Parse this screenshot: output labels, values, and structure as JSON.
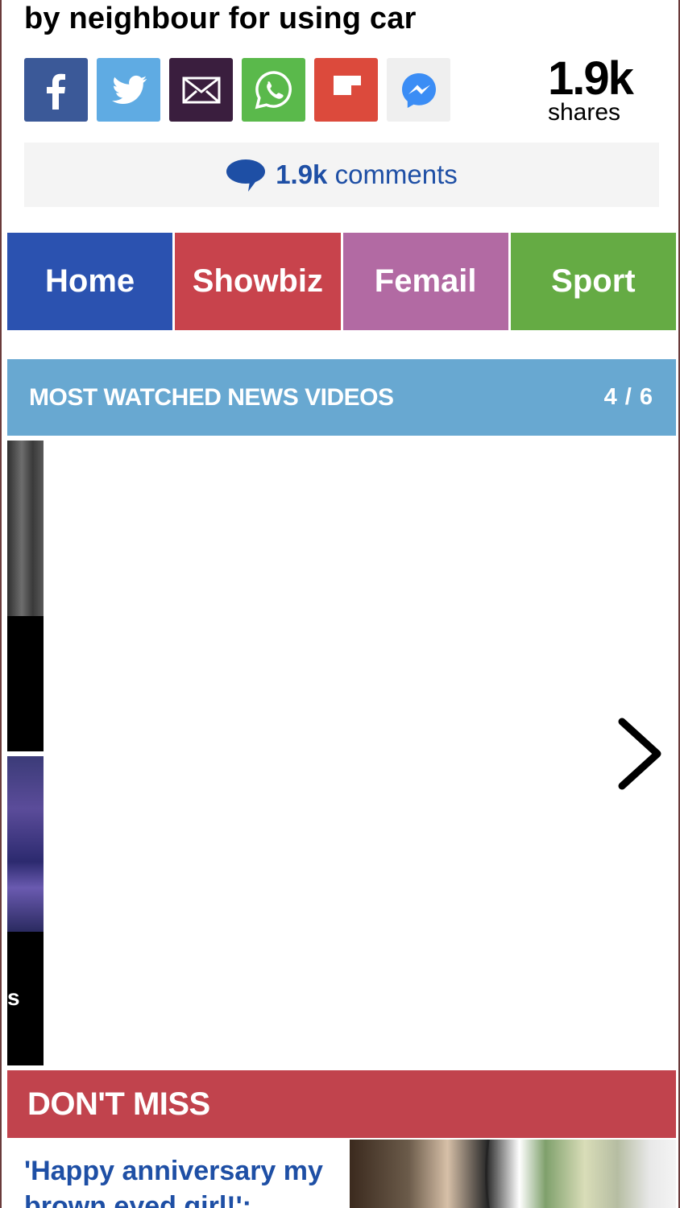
{
  "article": {
    "headline_tail": "by neighbour for using car"
  },
  "share": {
    "buttons": [
      {
        "name": "facebook",
        "icon": "facebook-icon",
        "color": "#3b5998"
      },
      {
        "name": "twitter",
        "icon": "twitter-icon",
        "color": "#5fabe3"
      },
      {
        "name": "email",
        "icon": "envelope-icon",
        "color": "#3a1e3e"
      },
      {
        "name": "whatsapp",
        "icon": "whatsapp-icon",
        "color": "#5ab94b"
      },
      {
        "name": "flipboard",
        "icon": "flipboard-icon",
        "color": "#dc4a3c"
      },
      {
        "name": "messenger",
        "icon": "messenger-icon",
        "color": "#efefef"
      }
    ],
    "count": "1.9k",
    "count_label": "shares"
  },
  "comments": {
    "count": "1.9k",
    "label": "comments"
  },
  "nav": {
    "items": [
      {
        "label": "Home",
        "color": "#2b52b0"
      },
      {
        "label": "Showbiz",
        "color": "#c8434c"
      },
      {
        "label": "Femail",
        "color": "#b26aa3"
      },
      {
        "label": "Sport",
        "color": "#65ab44"
      }
    ]
  },
  "most_watched": {
    "title": "MOST WATCHED NEWS VIDEOS",
    "counter": "4 / 6",
    "thumb_caption_fragment": "s",
    "accent": "#68a8d1"
  },
  "dont_miss": {
    "title": "DON'T MISS",
    "accent": "#c1434d",
    "story_headline": "'Happy anniversary my brown eyed girl!':"
  }
}
